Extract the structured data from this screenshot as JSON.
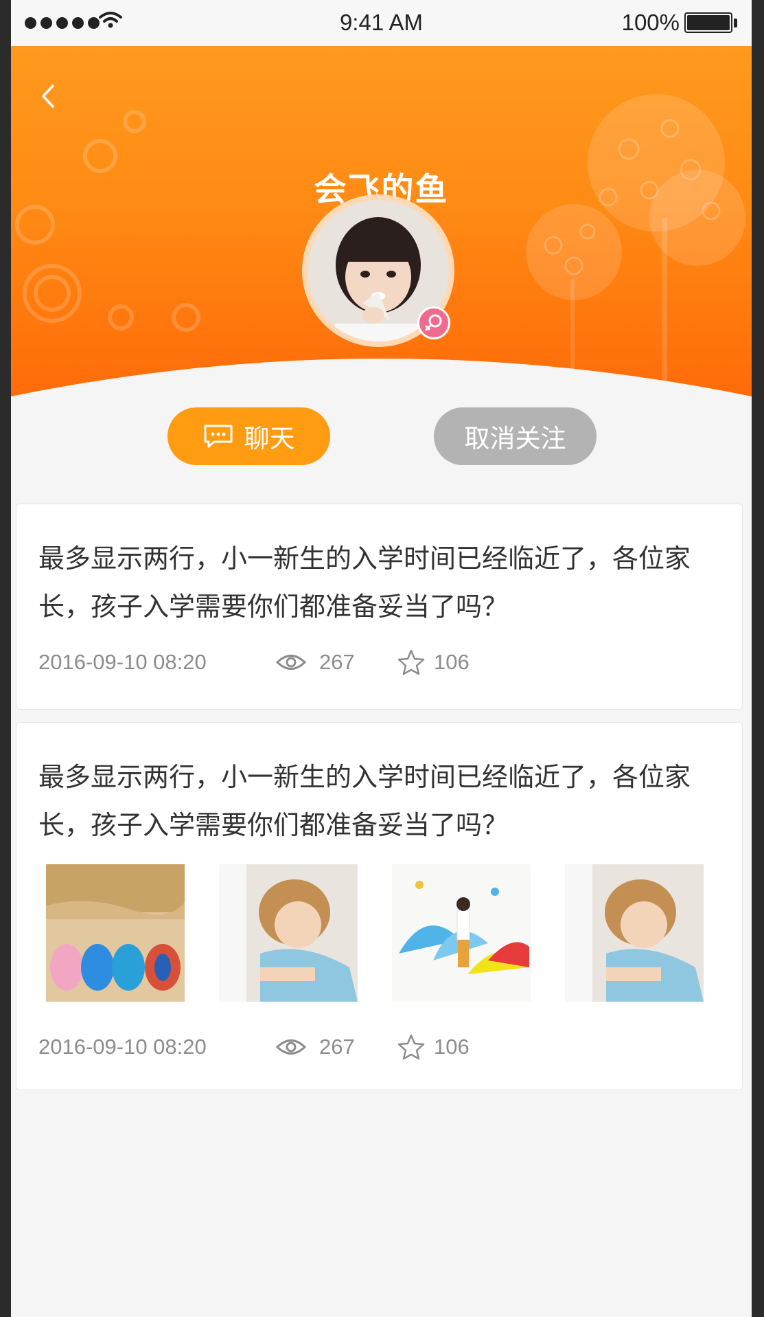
{
  "status_bar": {
    "time": "9:41 AM",
    "battery": "100%"
  },
  "profile": {
    "name": "会飞的鱼"
  },
  "actions": {
    "chat_label": "聊天",
    "unfollow_label": "取消关注"
  },
  "posts": [
    {
      "title": "最多显示两行，小一新生的入学时间已经临近了，各位家长，孩子入学需要你们都准备妥当了吗？",
      "date": "2016-09-10  08:20",
      "views": "267",
      "stars": "106",
      "images": []
    },
    {
      "title": "最多显示两行，小一新生的入学时间已经临近了，各位家长，孩子入学需要你们都准备妥当了吗？",
      "date": "2016-09-10  08:20",
      "views": "267",
      "stars": "106",
      "images": [
        "sandals-photo",
        "child-laptop-photo",
        "umbrella-child-photo",
        "child-laptop-photo"
      ]
    }
  ],
  "colors": {
    "header_orange": "#ff8a14",
    "chat_button": "#ff9c12",
    "unfollow_button": "#b3b3b3",
    "page_background": "#f5f5f5",
    "card_background": "#ffffff",
    "title_text": "#323232",
    "meta_text": "#8c8c8c"
  }
}
